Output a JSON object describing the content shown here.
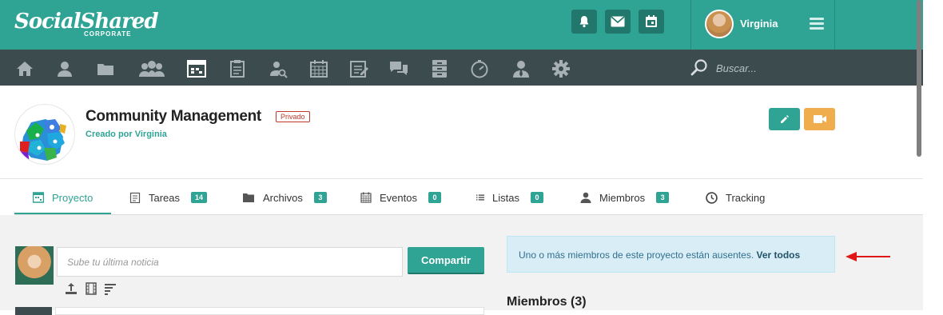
{
  "brand": {
    "logo_text": "SocialShared",
    "logo_sub": "CORPORATE",
    "primary_color": "#2fa394",
    "nav_color": "#3c4b4e",
    "warning_color": "#f0ad4e"
  },
  "topbar": {
    "icons": [
      "bell-icon",
      "mail-icon",
      "calendar-icon"
    ],
    "user_name": "Virginia"
  },
  "nav": {
    "icons": [
      "home-icon",
      "user-icon",
      "folder-icon",
      "group-icon",
      "project-icon",
      "clipboard-icon",
      "user-search-icon",
      "calendar-grid-icon",
      "edit-note-icon",
      "chat-icon",
      "cabinet-icon",
      "clock-icon",
      "user-tie-icon",
      "gear-icon"
    ],
    "search_placeholder": "Buscar..."
  },
  "project": {
    "title": "Community Management",
    "privacy_badge": "Privado",
    "created_by": "Creado por Virginia"
  },
  "tabs": [
    {
      "label": "Proyecto",
      "count": null,
      "icon": "project-icon",
      "active": true
    },
    {
      "label": "Tareas",
      "count": "14",
      "icon": "clipboard-icon"
    },
    {
      "label": "Archivos",
      "count": "3",
      "icon": "folder-icon"
    },
    {
      "label": "Eventos",
      "count": "0",
      "icon": "calendar-icon"
    },
    {
      "label": "Listas",
      "count": "0",
      "icon": "list-icon"
    },
    {
      "label": "Miembros",
      "count": "3",
      "icon": "user-icon"
    },
    {
      "label": "Tracking",
      "count": null,
      "icon": "clock-icon"
    }
  ],
  "feed": {
    "input_placeholder": "Sube tu última noticia",
    "share_label": "Compartir",
    "attach_icons": [
      "upload-icon",
      "film-icon",
      "text-format-icon"
    ]
  },
  "alert": {
    "text": "Uno o más miembros de este proyecto están ausentes.",
    "link": "Ver todos"
  },
  "members": {
    "title": "Miembros (3)"
  }
}
